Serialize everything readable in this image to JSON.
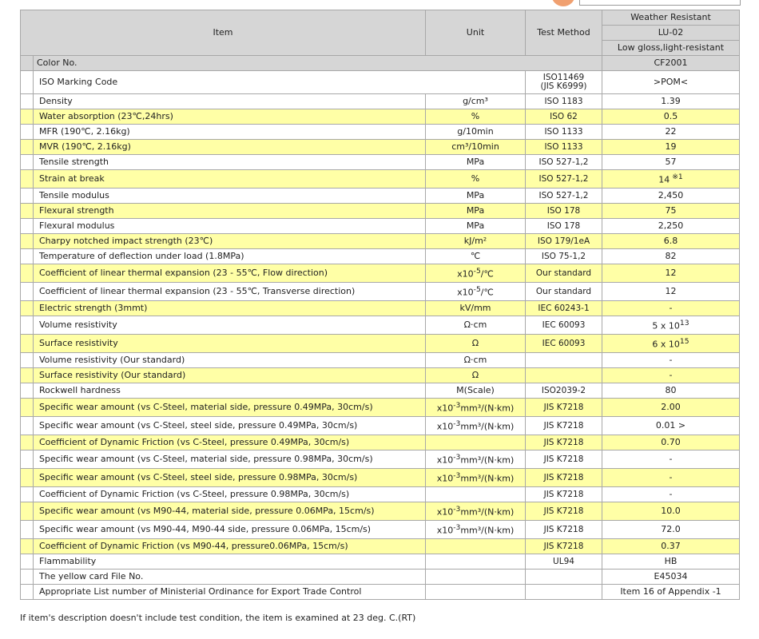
{
  "header": {
    "item": "Item",
    "unit": "Unit",
    "test_method": "Test Method",
    "grade_line1": "Weather Resistant",
    "grade_line2": "LU-02",
    "grade_line3": "Low gloss,light-resistant"
  },
  "color_row": {
    "label": "Color No.",
    "value": "CF2001"
  },
  "iso_row": {
    "label": "ISO Marking Code",
    "method_line1": "ISO11469",
    "method_line2": "(JIS K6999)",
    "value": ">POM<"
  },
  "rows": [
    {
      "item": "Density",
      "unit": "g/cm³",
      "method": "ISO 1183",
      "value": "1.39"
    },
    {
      "item": "Water absorption (23℃,24hrs)",
      "unit": "%",
      "method": "ISO 62",
      "value": "0.5"
    },
    {
      "item": "MFR (190℃, 2.16kg)",
      "unit": "g/10min",
      "method": "ISO 1133",
      "value": "22"
    },
    {
      "item": "MVR (190℃, 2.16kg)",
      "unit": "cm³/10min",
      "method": "ISO 1133",
      "value": "19"
    },
    {
      "item": "Tensile strength",
      "unit": "MPa",
      "method": "ISO 527-1,2",
      "value": "57"
    },
    {
      "item": "Strain at break",
      "unit": "%",
      "method": "ISO 527-1,2",
      "value": "14",
      "note": "※1"
    },
    {
      "item": "Tensile modulus",
      "unit": "MPa",
      "method": "ISO 527-1,2",
      "value": "2,450"
    },
    {
      "item": "Flexural strength",
      "unit": "MPa",
      "method": "ISO 178",
      "value": "75"
    },
    {
      "item": "Flexural modulus",
      "unit": "MPa",
      "method": "ISO 178",
      "value": "2,250"
    },
    {
      "item": "Charpy notched impact strength (23℃)",
      "unit": "kJ/m²",
      "method": "ISO 179/1eA",
      "value": "6.8"
    },
    {
      "item": "Temperature of deflection under load (1.8MPa)",
      "unit": "℃",
      "method": "ISO 75-1,2",
      "value": "82"
    },
    {
      "item": "Coefficient of linear thermal expansion (23 - 55℃, Flow direction)",
      "unit_base": "x10",
      "unit_exp": "-5",
      "unit_tail": "/℃",
      "method": "Our standard",
      "value": "12"
    },
    {
      "item": "Coefficient of linear thermal expansion (23 - 55℃, Transverse direction)",
      "unit_base": "x10",
      "unit_exp": "-5",
      "unit_tail": "/℃",
      "method": "Our standard",
      "value": "12"
    },
    {
      "item": "Electric strength (3mmt)",
      "unit": "kV/mm",
      "method": "IEC 60243-1",
      "value": "-"
    },
    {
      "item": "Volume resistivity",
      "unit": "Ω·cm",
      "method": "IEC 60093",
      "value_base": "5 x 10",
      "value_exp": "13"
    },
    {
      "item": "Surface resistivity",
      "unit": "Ω",
      "method": "IEC 60093",
      "value_base": "6 x 10",
      "value_exp": "15"
    },
    {
      "item": "Volume resistivity (Our standard)",
      "unit": "Ω·cm",
      "method": "",
      "value": "-"
    },
    {
      "item": "Surface resistivity (Our standard)",
      "unit": "Ω",
      "method": "",
      "value": "-"
    },
    {
      "item": "Rockwell hardness",
      "unit": "M(Scale)",
      "method": "ISO2039-2",
      "value": "80"
    },
    {
      "item": "Specific wear amount (vs C-Steel, material side, pressure 0.49MPa, 30cm/s)",
      "unit_base": "x10",
      "unit_exp": "-3",
      "unit_tail": "mm³/(N·km)",
      "method": "JIS K7218",
      "value": "2.00"
    },
    {
      "item": "Specific wear amount (vs C-Steel, steel side, pressure 0.49MPa, 30cm/s)",
      "unit_base": "x10",
      "unit_exp": "-3",
      "unit_tail": "mm³/(N·km)",
      "method": "JIS K7218",
      "value": "0.01 >"
    },
    {
      "item": "Coefficient of Dynamic Friction (vs C-Steel, pressure 0.49MPa, 30cm/s)",
      "unit": "",
      "method": "JIS K7218",
      "value": "0.70"
    },
    {
      "item": "Specific wear amount (vs C-Steel, material side, pressure 0.98MPa, 30cm/s)",
      "unit_base": "x10",
      "unit_exp": "-3",
      "unit_tail": "mm³/(N·km)",
      "method": "JIS K7218",
      "value": "-"
    },
    {
      "item": "Specific wear amount (vs C-Steel, steel side, pressure 0.98MPa, 30cm/s)",
      "unit_base": "x10",
      "unit_exp": "-3",
      "unit_tail": "mm³/(N·km)",
      "method": "JIS K7218",
      "value": "-"
    },
    {
      "item": "Coefficient of Dynamic Friction (vs C-Steel, pressure 0.98MPa, 30cm/s)",
      "unit": "",
      "method": "JIS K7218",
      "value": "-"
    },
    {
      "item": "Specific wear amount (vs M90-44, material side, pressure 0.06MPa, 15cm/s)",
      "unit_base": "x10",
      "unit_exp": "-3",
      "unit_tail": "mm³/(N·km)",
      "method": "JIS K7218",
      "value": "10.0"
    },
    {
      "item": "Specific wear amount (vs M90-44, M90-44 side, pressure 0.06MPa, 15cm/s)",
      "unit_base": "x10",
      "unit_exp": "-3",
      "unit_tail": "mm³/(N·km)",
      "method": "JIS K7218",
      "value": "72.0"
    },
    {
      "item": "Coefficient of Dynamic Friction (vs M90-44, pressure0.06MPa, 15cm/s)",
      "unit": "",
      "method": "JIS K7218",
      "value": "0.37"
    },
    {
      "item": "Flammability",
      "unit": "",
      "method": "UL94",
      "value": "HB"
    },
    {
      "item": "The yellow card File No.",
      "unit": "",
      "method": "",
      "value": "E45034"
    },
    {
      "item": "Appropriate List number of Ministerial Ordinance for Export Trade Control",
      "unit": "",
      "method": "",
      "value": "Item 16 of Appendix -1"
    }
  ],
  "footnote": "If item's description doesn't include test condition, the item is examined at 23 deg. C.(RT)",
  "colors": {
    "highlight": "#ffffa6",
    "header_bg": "#d6d6d6",
    "border": "#a8a8a8"
  }
}
